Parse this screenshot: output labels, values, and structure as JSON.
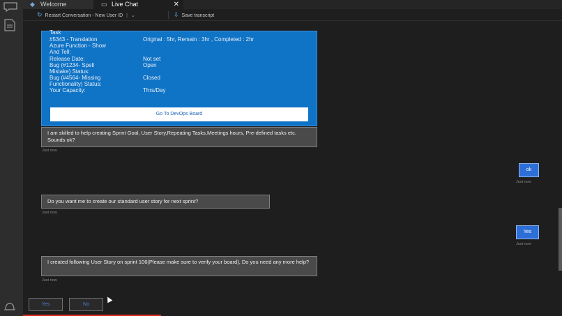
{
  "tabs": [
    {
      "label": "Welcome",
      "icon": "vscode-icon"
    },
    {
      "label": "Live Chat",
      "icon": "chat-icon",
      "active": true
    }
  ],
  "toolbar": {
    "restart_label": "Restart Conversation - New User ID",
    "save_label": "Save transcript"
  },
  "card": {
    "rows": [
      {
        "key": "Task",
        "value": ""
      },
      {
        "key": "#5343 - Translation",
        "value": "Original : 5hr, Remain : 3hr , Completed : 2hr"
      },
      {
        "key": "Azure Function - Show",
        "value": ""
      },
      {
        "key": "And Tell:",
        "value": ""
      },
      {
        "key": "Release Date:",
        "value": "Not set"
      },
      {
        "key": "Bug (#1234- Spell",
        "value": "Open"
      },
      {
        "key": "Mistake) Status:",
        "value": ""
      },
      {
        "key": "Bug (#4564- Missing",
        "value": "Closed"
      },
      {
        "key": "Functionality) Status:",
        "value": ""
      },
      {
        "key": "Your Capacity:",
        "value": "Thrs/Day"
      }
    ],
    "button_label": "Go To DevOps Board"
  },
  "messages": [
    {
      "from": "bot",
      "text": "I am skilled to help creating Sprint Goal, User Story,Repeating Tasks,Meetings hours, Pre-defined tasks etc. Sounds ok?",
      "time": "Just now"
    },
    {
      "from": "user",
      "text": "ok",
      "time": "Just now"
    },
    {
      "from": "bot",
      "text": "Do you want me to create our standard user story for next sprint?",
      "time": "Just now"
    },
    {
      "from": "user",
      "text": "Yes",
      "time": "Just now"
    },
    {
      "from": "bot",
      "text": "I created following User Story on sprint 106(Please make sure to verify your board), Do you need any more help?",
      "time": "Just now"
    }
  ],
  "suggested_actions": [
    "Yes",
    "No"
  ],
  "colors": {
    "card": "#0f73c6",
    "user_bubble": "#2d6fd6",
    "bot_bubble": "#4a4a4a",
    "accent": "#1a5fb4"
  }
}
